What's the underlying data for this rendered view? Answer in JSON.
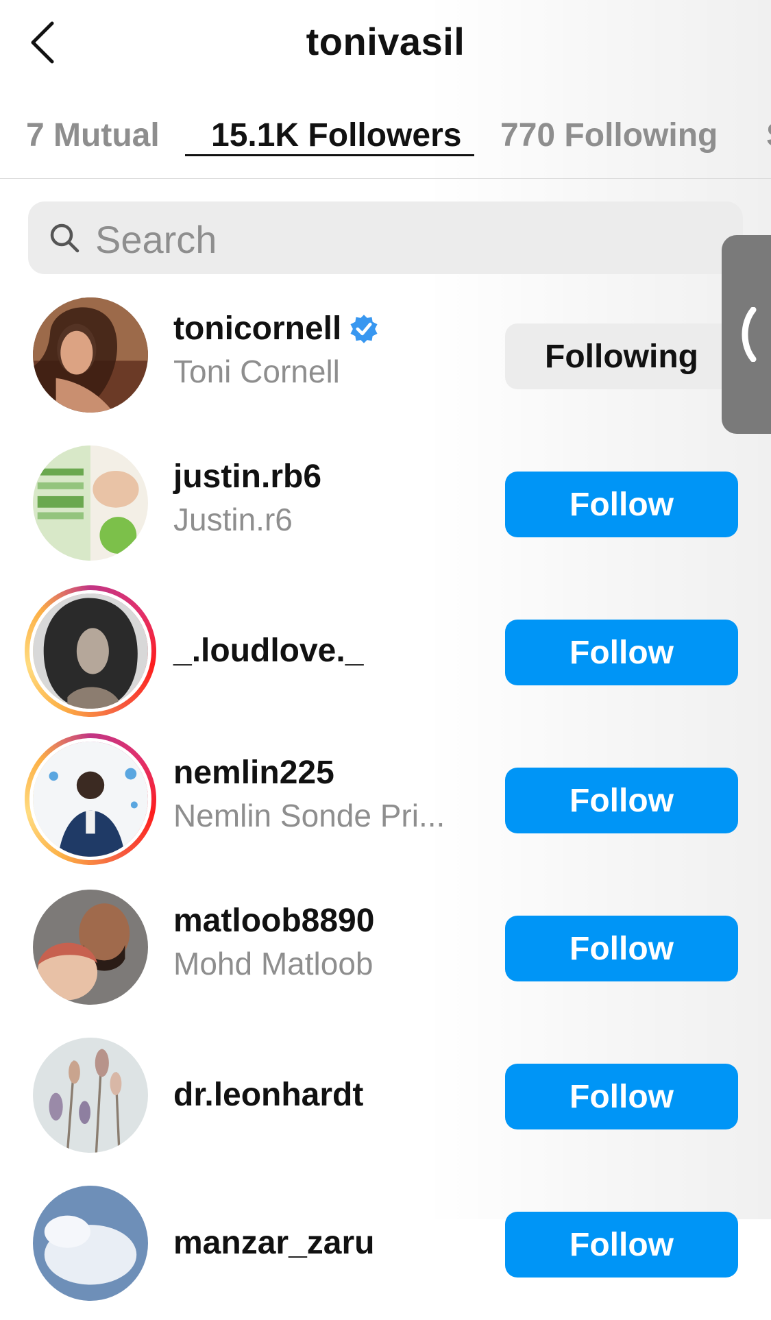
{
  "header": {
    "title": "tonivasil"
  },
  "tabs": [
    {
      "label": "7 Mutual"
    },
    {
      "label": "15.1K Followers"
    },
    {
      "label": "770 Following"
    },
    {
      "label": "S"
    }
  ],
  "search": {
    "placeholder": "Search"
  },
  "users": [
    {
      "username": "tonicornell",
      "fullname": "Toni Cornell",
      "verified": true,
      "button": "Following"
    },
    {
      "username": "justin.rb6",
      "fullname": "Justin.r6",
      "button": "Follow"
    },
    {
      "username": "_.loudlove._",
      "fullname": "",
      "button": "Follow",
      "story_ring": true
    },
    {
      "username": "nemlin225",
      "fullname": "Nemlin Sonde Pri...",
      "button": "Follow",
      "story_ring": true
    },
    {
      "username": "matloob8890",
      "fullname": "Mohd Matloob",
      "button": "Follow"
    },
    {
      "username": "dr.leonhardt",
      "fullname": "",
      "button": "Follow"
    },
    {
      "username": "manzar_zaru",
      "fullname": "",
      "button": "Follow"
    }
  ],
  "colors": {
    "follow_blue": "#0095f6",
    "verified_blue": "#3897f0",
    "secondary_text": "#8e8e8e"
  }
}
